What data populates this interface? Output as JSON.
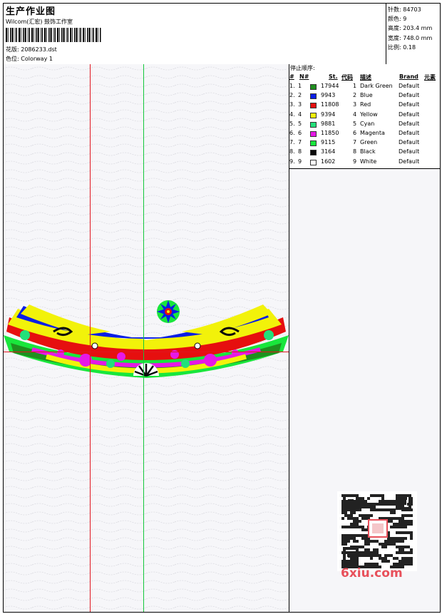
{
  "header": {
    "title": "生产作业图",
    "subtitle": "Wilcom(汇宏) 鼓饰工作室",
    "pattern": "花版: 2086233.dst",
    "colorway": "色位: Colorway 1"
  },
  "stats": {
    "stitches": "针数: 84703",
    "colors": "颜色: 9",
    "height": "高度: 203.4 mm",
    "width": "宽度: 748.0 mm",
    "scale": "比例: 0.18"
  },
  "stop_sequence": {
    "title": "停止顺序:",
    "headers": [
      "#",
      "N#",
      "St.",
      "代码",
      "描述",
      "Brand",
      "元素"
    ],
    "rows": [
      {
        "idx": "1.",
        "n": "1",
        "st": "17944",
        "code": "1",
        "desc": "Dark Green",
        "brand": "Default",
        "color": "#1f8f1f"
      },
      {
        "idx": "2.",
        "n": "2",
        "st": "9943",
        "code": "2",
        "desc": "Blue",
        "brand": "Default",
        "color": "#0a1ee6"
      },
      {
        "idx": "3.",
        "n": "3",
        "st": "11808",
        "code": "3",
        "desc": "Red",
        "brand": "Default",
        "color": "#e60f0f"
      },
      {
        "idx": "4.",
        "n": "4",
        "st": "9394",
        "code": "4",
        "desc": "Yellow",
        "brand": "Default",
        "color": "#f2f20a"
      },
      {
        "idx": "5.",
        "n": "5",
        "st": "9881",
        "code": "5",
        "desc": "Cyan",
        "brand": "Default",
        "color": "#23e07a"
      },
      {
        "idx": "6.",
        "n": "6",
        "st": "11850",
        "code": "6",
        "desc": "Magenta",
        "brand": "Default",
        "color": "#e619e6"
      },
      {
        "idx": "7.",
        "n": "7",
        "st": "9115",
        "code": "7",
        "desc": "Green",
        "brand": "Default",
        "color": "#19e63c"
      },
      {
        "idx": "8.",
        "n": "8",
        "st": "3164",
        "code": "8",
        "desc": "Black",
        "brand": "Default",
        "color": "#0a0a0a"
      },
      {
        "idx": "9.",
        "n": "9",
        "st": "1602",
        "code": "9",
        "desc": "White",
        "brand": "Default",
        "color": "#ffffff"
      }
    ]
  },
  "watermark": {
    "logo_text": "6xiu.com",
    "qr_icon": "qr-code-icon"
  },
  "guides": {
    "vertical_red": "#e0141e",
    "vertical_green": "#14c83c",
    "horizontal_red": "#e0141e"
  }
}
